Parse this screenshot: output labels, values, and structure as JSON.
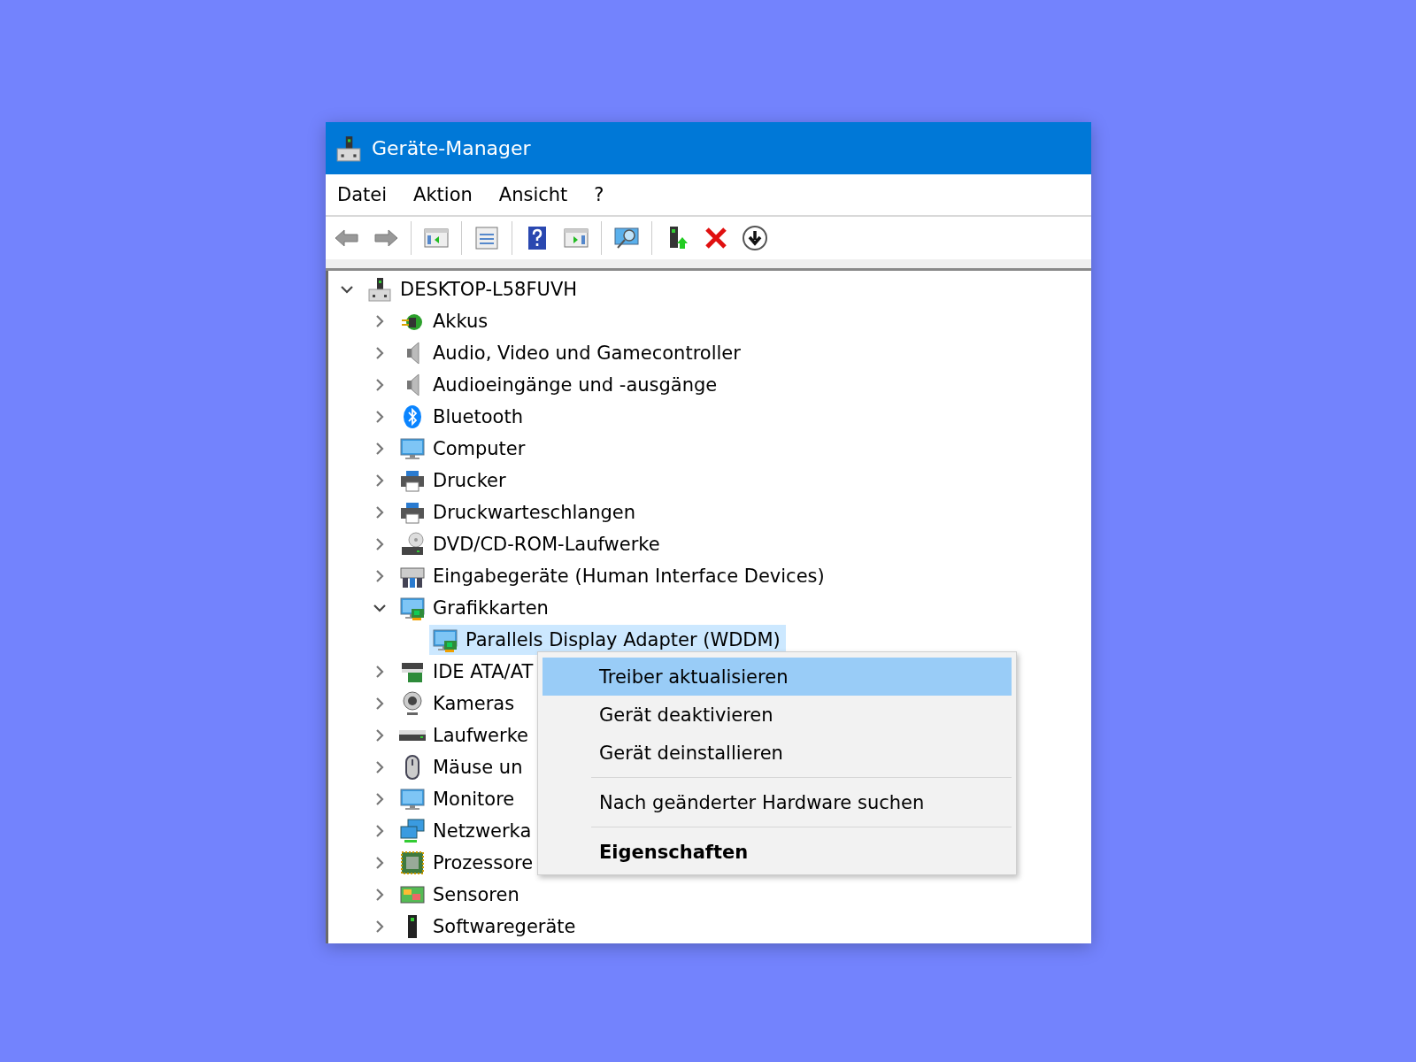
{
  "window": {
    "title": "Geräte-Manager"
  },
  "menu_bar": [
    "Datei",
    "Aktion",
    "Ansicht",
    "?"
  ],
  "tree": {
    "label": "DESKTOP-L58FUVH",
    "expanded": true,
    "selected": false,
    "children": [
      {
        "label": "Akkus",
        "expanded": false,
        "selected": false
      },
      {
        "label": "Audio, Video und Gamecontroller",
        "expanded": false,
        "selected": false
      },
      {
        "label": "Audioeingänge und -ausgänge",
        "expanded": false,
        "selected": false
      },
      {
        "label": "Bluetooth",
        "expanded": false,
        "selected": false
      },
      {
        "label": "Computer",
        "expanded": false,
        "selected": false
      },
      {
        "label": "Drucker",
        "expanded": false,
        "selected": false
      },
      {
        "label": "Druckwarteschlangen",
        "expanded": false,
        "selected": false
      },
      {
        "label": "DVD/CD-ROM-Laufwerke",
        "expanded": false,
        "selected": false
      },
      {
        "label": "Eingabegeräte (Human Interface Devices)",
        "expanded": false,
        "selected": false
      },
      {
        "label": "Grafikkarten",
        "expanded": true,
        "selected": false,
        "children": [
          {
            "label": "Parallels Display Adapter (WDDM)",
            "selected": true
          }
        ]
      },
      {
        "label": "IDE ATA/AT",
        "expanded": false,
        "selected": false
      },
      {
        "label": "Kameras",
        "expanded": false,
        "selected": false
      },
      {
        "label": "Laufwerke",
        "expanded": false,
        "selected": false
      },
      {
        "label": "Mäuse un",
        "expanded": false,
        "selected": false
      },
      {
        "label": "Monitore",
        "expanded": false,
        "selected": false
      },
      {
        "label": "Netzwerka",
        "expanded": false,
        "selected": false
      },
      {
        "label": "Prozessore",
        "expanded": false,
        "selected": false
      },
      {
        "label": "Sensoren",
        "expanded": false,
        "selected": false
      },
      {
        "label": "Softwaregeräte",
        "expanded": false,
        "selected": false
      }
    ]
  },
  "context_menu": {
    "groups": [
      [
        {
          "label": "Treiber aktualisieren",
          "selected": true,
          "default": false
        },
        {
          "label": "Gerät deaktivieren",
          "selected": false,
          "default": false
        },
        {
          "label": "Gerät deinstallieren",
          "selected": false,
          "default": false
        }
      ],
      [
        {
          "label": "Nach geänderter Hardware suchen",
          "selected": false,
          "default": false
        }
      ],
      [
        {
          "label": "Eigenschaften",
          "selected": false,
          "default": true
        }
      ]
    ]
  }
}
